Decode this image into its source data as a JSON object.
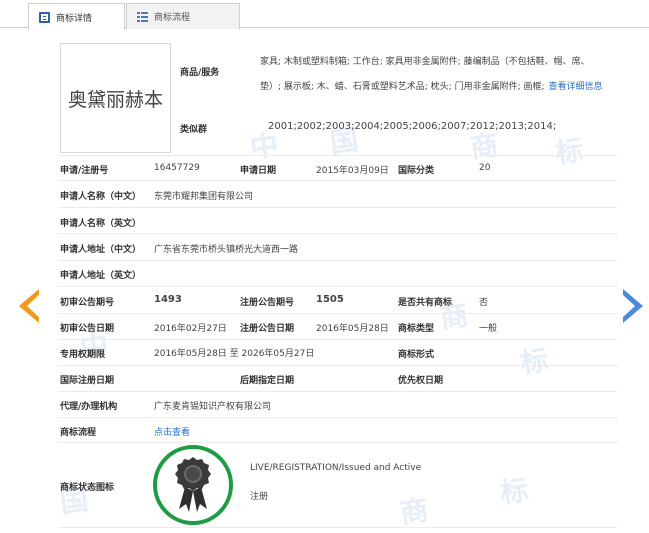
{
  "tabs": [
    {
      "label": "商标详情"
    },
    {
      "label": "商标流程"
    }
  ],
  "logo": {
    "text": "奥黛丽赫本"
  },
  "goods": {
    "label": "商品/服务",
    "text": "家具; 木制或塑料制箱; 工作台; 家具用非金属附件; 藤编制品（不包括鞋、帽、席、垫）; 展示板; 木、蜡、石膏或塑料艺术品; 枕头; 门用非金属附件; 画框;",
    "link": "查看详细信息"
  },
  "similar": {
    "label": "类似群",
    "value": "2001;2002;2003;2004;2005;2006;2007;2012;2013;2014;"
  },
  "fields": {
    "app_no_label": "申请/注册号",
    "app_no": "16457729",
    "app_date_label": "申请日期",
    "app_date": "2015年03月09日",
    "intl_class_label": "国际分类",
    "intl_class": "20",
    "applicant_cn_label": "申请人名称（中文）",
    "applicant_cn": "东莞市耀邦集团有限公司",
    "applicant_en_label": "申请人名称（英文）",
    "address_cn_label": "申请人地址（中文）",
    "address_cn": "广东省东莞市桥头镇桥光大道西一路",
    "address_en_label": "申请人地址（英文）",
    "pre_pub_no_label": "初审公告期号",
    "pre_pub_no": "1493",
    "reg_pub_no_label": "注册公告期号",
    "reg_pub_no": "1505",
    "shared_label": "是否共有商标",
    "shared": "否",
    "pre_pub_date_label": "初审公告日期",
    "pre_pub_date": "2016年02月27日",
    "reg_pub_date_label": "注册公告日期",
    "reg_pub_date": "2016年05月28日",
    "tm_type_label": "商标类型",
    "tm_type": "一般",
    "exclusive_label": "专用权期限",
    "exclusive": "2016年05月28日 至 2026年05月27日",
    "tm_form_label": "商标形式",
    "intl_reg_date_label": "国际注册日期",
    "later_date_label": "后期指定日期",
    "priority_date_label": "优先权日期",
    "agent_label": "代理/办理机构",
    "agent": "广东麦肯锡知识产权有限公司",
    "flow_label": "商标流程",
    "flow_link": "点击查看",
    "status_label": "商标状态图标",
    "status_en": "LIVE/REGISTRATION/Issued and Active",
    "status_cn": "注册"
  },
  "watermark": [
    "中",
    "国",
    "商",
    "标"
  ],
  "colors": {
    "accent": "#2a6ec5",
    "prev_arrow": "#f29a1e",
    "next_arrow": "#4a8ad8",
    "status_ring": "#1f9b43"
  }
}
